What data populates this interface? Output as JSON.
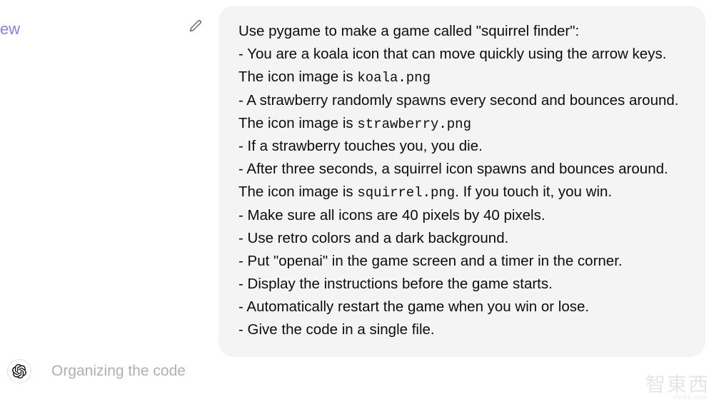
{
  "sidebar": {
    "partial_text": "ew"
  },
  "message": {
    "intro": "Use pygame to make a game called \"squirrel finder\":",
    "bullets": [
      {
        "prefix": "- You are a koala icon that can move quickly using the arrow keys. The icon image is ",
        "code": "koala.png",
        "suffix": ""
      },
      {
        "prefix": "- A strawberry randomly spawns every second and bounces around. The icon image is ",
        "code": "strawberry.png",
        "suffix": ""
      },
      {
        "prefix": "- If a strawberry touches you, you die.",
        "code": "",
        "suffix": ""
      },
      {
        "prefix": "- After three seconds, a squirrel icon spawns and bounces around. The icon image is ",
        "code": "squirrel.png",
        "suffix": ". If you touch it, you win."
      },
      {
        "prefix": "- Make sure all icons are 40 pixels by 40 pixels.",
        "code": "",
        "suffix": ""
      },
      {
        "prefix": "- Use retro colors and a dark background.",
        "code": "",
        "suffix": ""
      },
      {
        "prefix": "- Put \"openai\" in the game screen and a timer in the corner.",
        "code": "",
        "suffix": ""
      },
      {
        "prefix": "- Display the instructions before the game starts.",
        "code": "",
        "suffix": ""
      },
      {
        "prefix": "- Automatically restart the game when you win or lose.",
        "code": "",
        "suffix": ""
      },
      {
        "prefix": "- Give the code in a single file.",
        "code": "",
        "suffix": ""
      }
    ]
  },
  "assistant": {
    "status_text": "Organizing the code"
  },
  "watermark": {
    "main": "智東西",
    "sub": "zhidx.com"
  }
}
